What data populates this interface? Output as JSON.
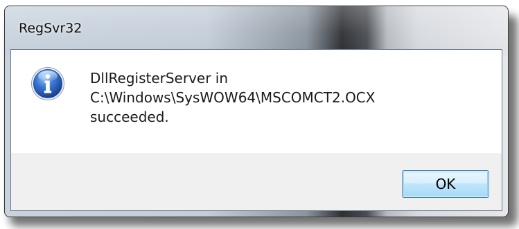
{
  "window": {
    "title": "RegSvr32"
  },
  "dialog": {
    "icon": "info-icon",
    "message_lines": [
      "DllRegisterServer in",
      "C:\\Windows\\SysWOW64\\MSCOMCT2.OCX",
      "succeeded."
    ],
    "ok_label": "OK"
  },
  "colors": {
    "icon_blue": "#2f6fc9",
    "button_border": "#3c7fb1",
    "button_area": "#f0f0f0"
  }
}
